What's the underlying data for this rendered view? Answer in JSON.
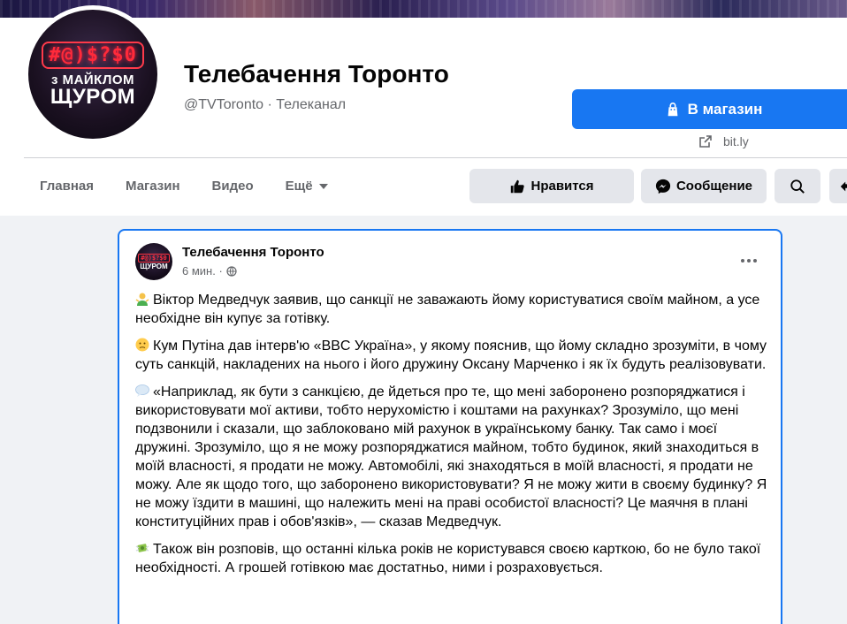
{
  "page": {
    "name": "Телебачення Торонто",
    "handle": "@TVToronto · Телеканал",
    "avatar": {
      "symbols": "#@)$?$0",
      "line1": "з МАЙКЛОМ",
      "line2": "ЩУРОМ"
    }
  },
  "header_actions": {
    "shop_label": "В магазин",
    "link_text": "bit.ly"
  },
  "nav": {
    "items": [
      {
        "label": "Главная"
      },
      {
        "label": "Магазин"
      },
      {
        "label": "Видео"
      },
      {
        "label": "Ещё"
      }
    ]
  },
  "actions": {
    "like_label": "Нравится",
    "message_label": "Сообщение"
  },
  "post": {
    "author": "Телебачення Торонто",
    "time": "6 мин. ·",
    "paragraphs": [
      "Віктор Медведчук заявив, що санкції не заважають йому користуватися своїм майном, а усе необхідне він купує за готівку.",
      "Кум Путіна дав інтерв'ю «BBC Україна», у якому пояснив, що йому складно зрозуміти, в чому суть санкцій, накладених на нього і його дружину Оксану Марченко і як їх будуть реалізовувати.",
      "«Наприклад, як бути з санкцією, де йдеться про те, що мені заборонено розпоряджатися і використовувати мої активи, тобто нерухомістю і коштами на рахунках? Зрозуміло, що мені подзвонили і сказали, що заблоковано мій рахунок в українському банку. Так само і моєї дружині. Зрозуміло, що я не можу розпоряджатися майном, тобто будинок, який знаходиться в моїй власності, я продати не можу. Автомобілі, які знаходяться в моїй власності, я продати не можу. Але як щодо того, що заборонено використовувати? Я не можу жити в своєму будинку? Я не можу їздити в машині, що належить мені на праві особистої власності? Це маячня в плані конституційних прав і обов'язків», — сказав Медведчук.",
      "Також він розповів, що останні кілька років не користувався своєю карткою, бо не було такої необхідності. А грошей готівкою має достатньо, ними і розраховується."
    ],
    "emoji_icons": [
      "man-shrugging-icon",
      "confused-face-icon",
      "speech-bubble-icon",
      "money-wings-icon"
    ]
  },
  "colors": {
    "accent": "#1877f2",
    "secondary_button": "#e4e6eb",
    "muted_text": "#65676b",
    "background": "#f0f2f5"
  }
}
